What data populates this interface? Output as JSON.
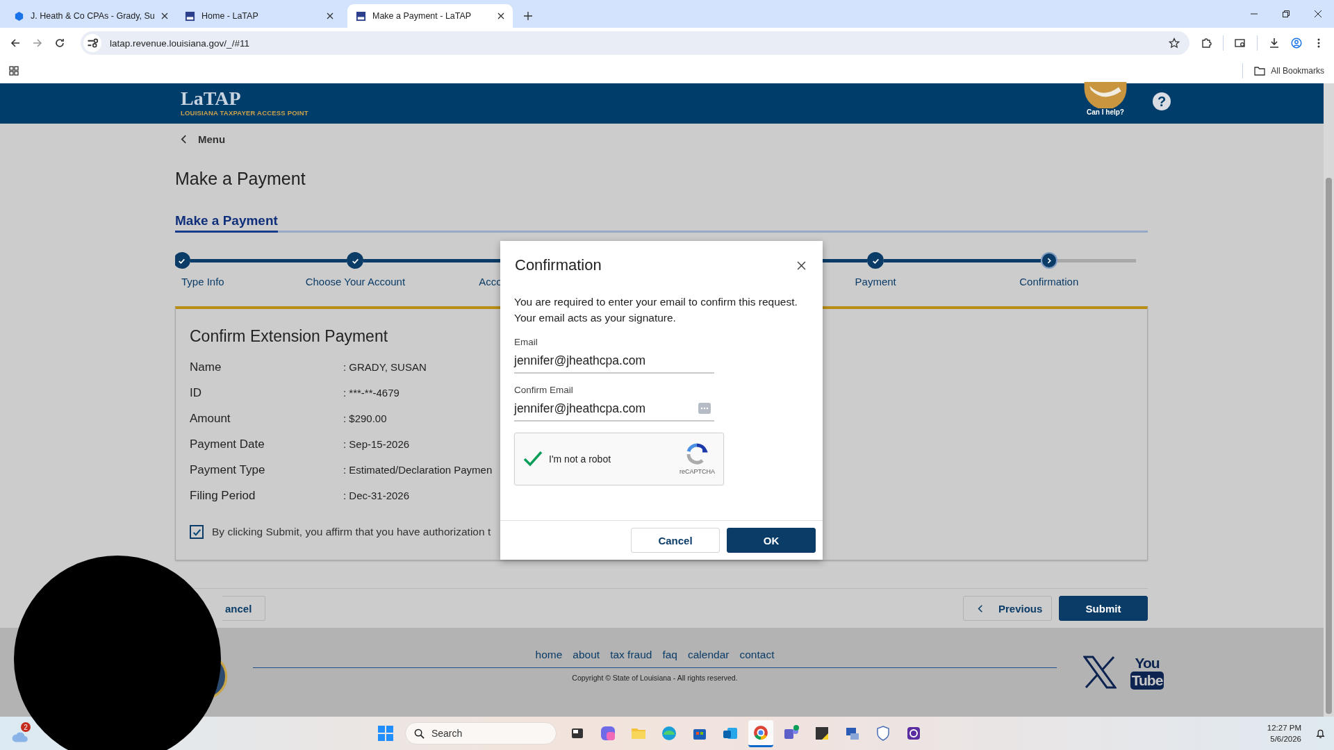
{
  "browser": {
    "tabs": [
      {
        "title": "J. Heath & Co CPAs - Grady, Su",
        "selected": false
      },
      {
        "title": "Home - LaTAP",
        "selected": false
      },
      {
        "title": "Make a Payment - LaTAP",
        "selected": true
      }
    ],
    "url": "latap.revenue.louisiana.gov/_/#11",
    "bookmarks_label": "All Bookmarks"
  },
  "header": {
    "logo_text": "LaTAP",
    "logo_tagline": "LOUISIANA TAXPAYER ACCESS POINT",
    "assistant_label": "Can I help?",
    "help_icon": "?"
  },
  "menu_label": "Menu",
  "page_title": "Make a Payment",
  "section_tab": {
    "label": "Make a Payment",
    "selected": true
  },
  "steps": [
    {
      "label": "Type Info",
      "completed": true,
      "selected": false
    },
    {
      "label": "Choose Your Account",
      "completed": true,
      "selected": false
    },
    {
      "label": "Acco"
    },
    {
      "label": "Payment",
      "completed": true,
      "selected": false
    },
    {
      "label": "Confirmation",
      "completed": false,
      "selected": true
    }
  ],
  "card": {
    "title": "Confirm Extension Payment",
    "rows": [
      {
        "label": "Name",
        "value": ": GRADY, SUSAN"
      },
      {
        "label": "ID",
        "value": ": ***-**-4679"
      },
      {
        "label": "Amount",
        "value": ": $290.00"
      },
      {
        "label": "Payment Date",
        "value": ": Sep-15-2026"
      },
      {
        "label": "Payment Type",
        "value": ": Estimated/Declaration Paymen"
      },
      {
        "label": "Filing Period",
        "value": ": Dec-31-2026"
      }
    ],
    "affirmation": {
      "checked": true,
      "text": "By clicking Submit, you affirm that you have authorization t"
    }
  },
  "actions": {
    "cancel": "ancel",
    "previous": "Previous",
    "submit": "Submit"
  },
  "footer": {
    "links": [
      "home",
      "about",
      "tax fraud",
      "faq",
      "calendar",
      "contact"
    ],
    "copyright": "Copyright © State of Louisiana - All rights reserved.",
    "youtube": [
      "You",
      "Tube"
    ]
  },
  "dialog": {
    "title": "Confirmation",
    "message": "You are required to enter your email to confirm this request. Your email acts as your signature.",
    "email_label": "Email",
    "email": "jennifer@jheathcpa.com",
    "confirm_label": "Confirm Email",
    "confirm_email": "jennifer@jheathcpa.com",
    "captcha": {
      "checked": true,
      "label": "I'm not a robot",
      "brand": "reCAPTCHA"
    },
    "cancel": "Cancel",
    "ok": "OK"
  },
  "taskbar": {
    "weather_badge": "2",
    "search_placeholder": "Search",
    "time": "12:27 PM",
    "date": "5/6/2026"
  }
}
